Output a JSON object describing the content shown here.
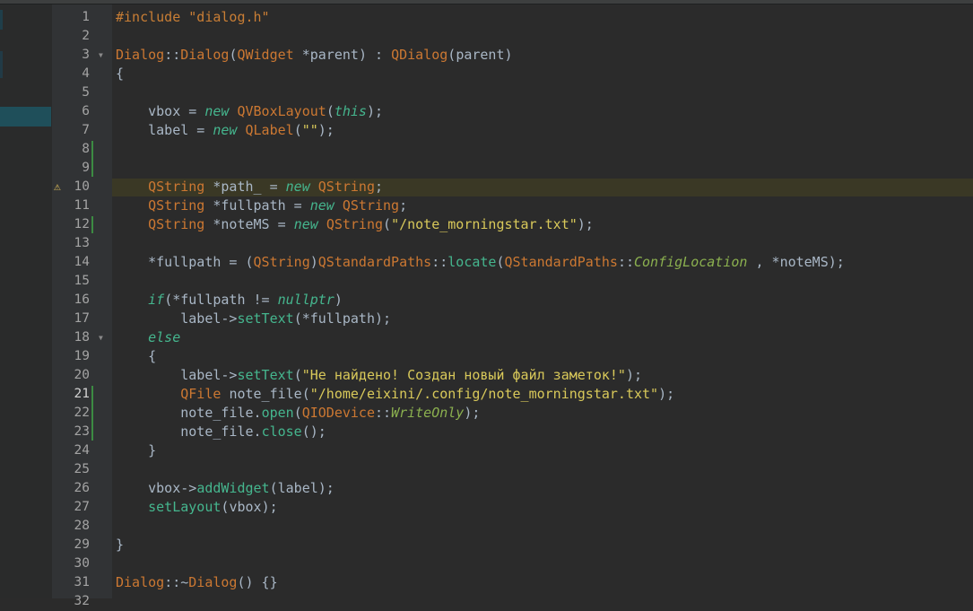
{
  "editor": {
    "language": "C++",
    "current_line": 21,
    "warning_line": 10,
    "lines": [
      {
        "num": "1",
        "code": "#include \"dialog.h\""
      },
      {
        "num": "2",
        "code": ""
      },
      {
        "num": "3",
        "code": "Dialog::Dialog(QWidget *parent) : QDialog(parent)"
      },
      {
        "num": "4",
        "code": "{"
      },
      {
        "num": "5",
        "code": ""
      },
      {
        "num": "6",
        "code": "    vbox = new QVBoxLayout(this);"
      },
      {
        "num": "7",
        "code": "    label = new QLabel(\"\");"
      },
      {
        "num": "8",
        "code": ""
      },
      {
        "num": "9",
        "code": ""
      },
      {
        "num": "10",
        "code": "    QString *path_ = new QString;"
      },
      {
        "num": "11",
        "code": "    QString *fullpath = new QString;"
      },
      {
        "num": "12",
        "code": "    QString *noteMS = new QString(\"/note_morningstar.txt\");"
      },
      {
        "num": "13",
        "code": ""
      },
      {
        "num": "14",
        "code": "    *fullpath = (QString)QStandardPaths::locate(QStandardPaths::ConfigLocation , *noteMS);"
      },
      {
        "num": "15",
        "code": ""
      },
      {
        "num": "16",
        "code": "    if(*fullpath != nullptr)"
      },
      {
        "num": "17",
        "code": "        label->setText(*fullpath);"
      },
      {
        "num": "18",
        "code": "    else"
      },
      {
        "num": "19",
        "code": "    {"
      },
      {
        "num": "20",
        "code": "        label->setText(\"Не найдено! Создан новый файл заметок!\");"
      },
      {
        "num": "21",
        "code": "        QFile note_file(\"/home/eixini/.config/note_morningstar.txt\");"
      },
      {
        "num": "22",
        "code": "        note_file.open(QIODevice::WriteOnly);"
      },
      {
        "num": "23",
        "code": "        note_file.close();"
      },
      {
        "num": "24",
        "code": "    }"
      },
      {
        "num": "25",
        "code": ""
      },
      {
        "num": "26",
        "code": "    vbox->addWidget(label);"
      },
      {
        "num": "27",
        "code": "    setLayout(vbox);"
      },
      {
        "num": "28",
        "code": ""
      },
      {
        "num": "29",
        "code": "}"
      },
      {
        "num": "30",
        "code": ""
      },
      {
        "num": "31",
        "code": "Dialog::~Dialog() {}"
      },
      {
        "num": "32",
        "code": ""
      }
    ],
    "fold_markers": [
      3,
      18
    ],
    "changed_lines": [
      8,
      9,
      12,
      21,
      22,
      23
    ],
    "colors": {
      "background": "#2b2b2b",
      "gutter": "#313335",
      "keyword": "#40b4b4",
      "string": "#d9c95a",
      "preprocessor": "#c97e35",
      "warning": "#e5c25b",
      "change_marker": "#3c8b42"
    }
  }
}
